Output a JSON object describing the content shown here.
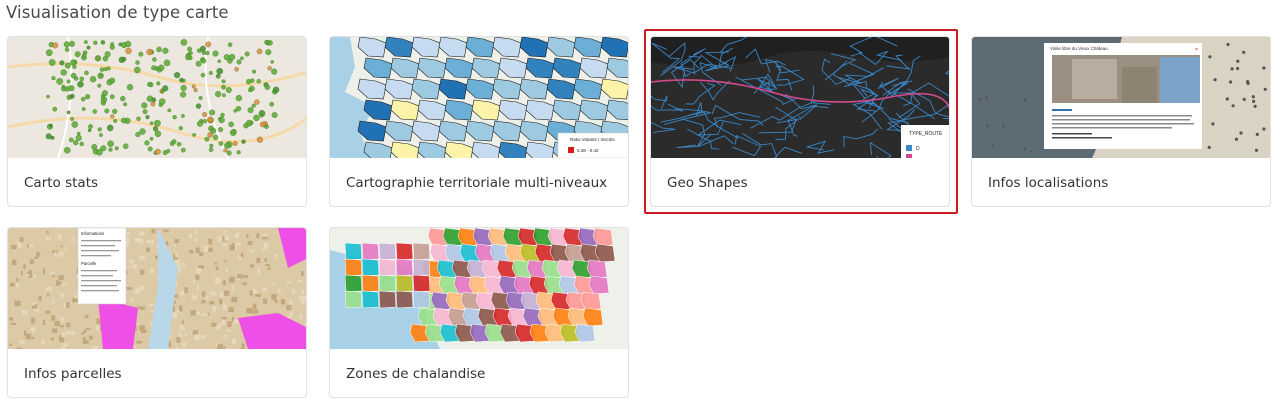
{
  "section": {
    "title": "Visualisation de type carte"
  },
  "cards": [
    {
      "label": "Carto stats"
    },
    {
      "label": "Cartographie territoriale multi-niveaux",
      "legend_title": "Ratio Votants / Inscrits",
      "legend_entry": "0.38 - 0.42"
    },
    {
      "label": "Geo Shapes",
      "legend_title": "TYPE_ROUTE",
      "legend_entry": "D",
      "selected": true
    },
    {
      "label": "Infos localisations",
      "popup_title": "Visite libre du Vieux Château"
    },
    {
      "label": "Infos parcelles",
      "popup_title": "Informations",
      "popup_subtitle": "Parcelle"
    },
    {
      "label": "Zones de chalandise"
    }
  ],
  "colors": {
    "selection": "#c81d23",
    "card_border": "#e2e2e2"
  }
}
